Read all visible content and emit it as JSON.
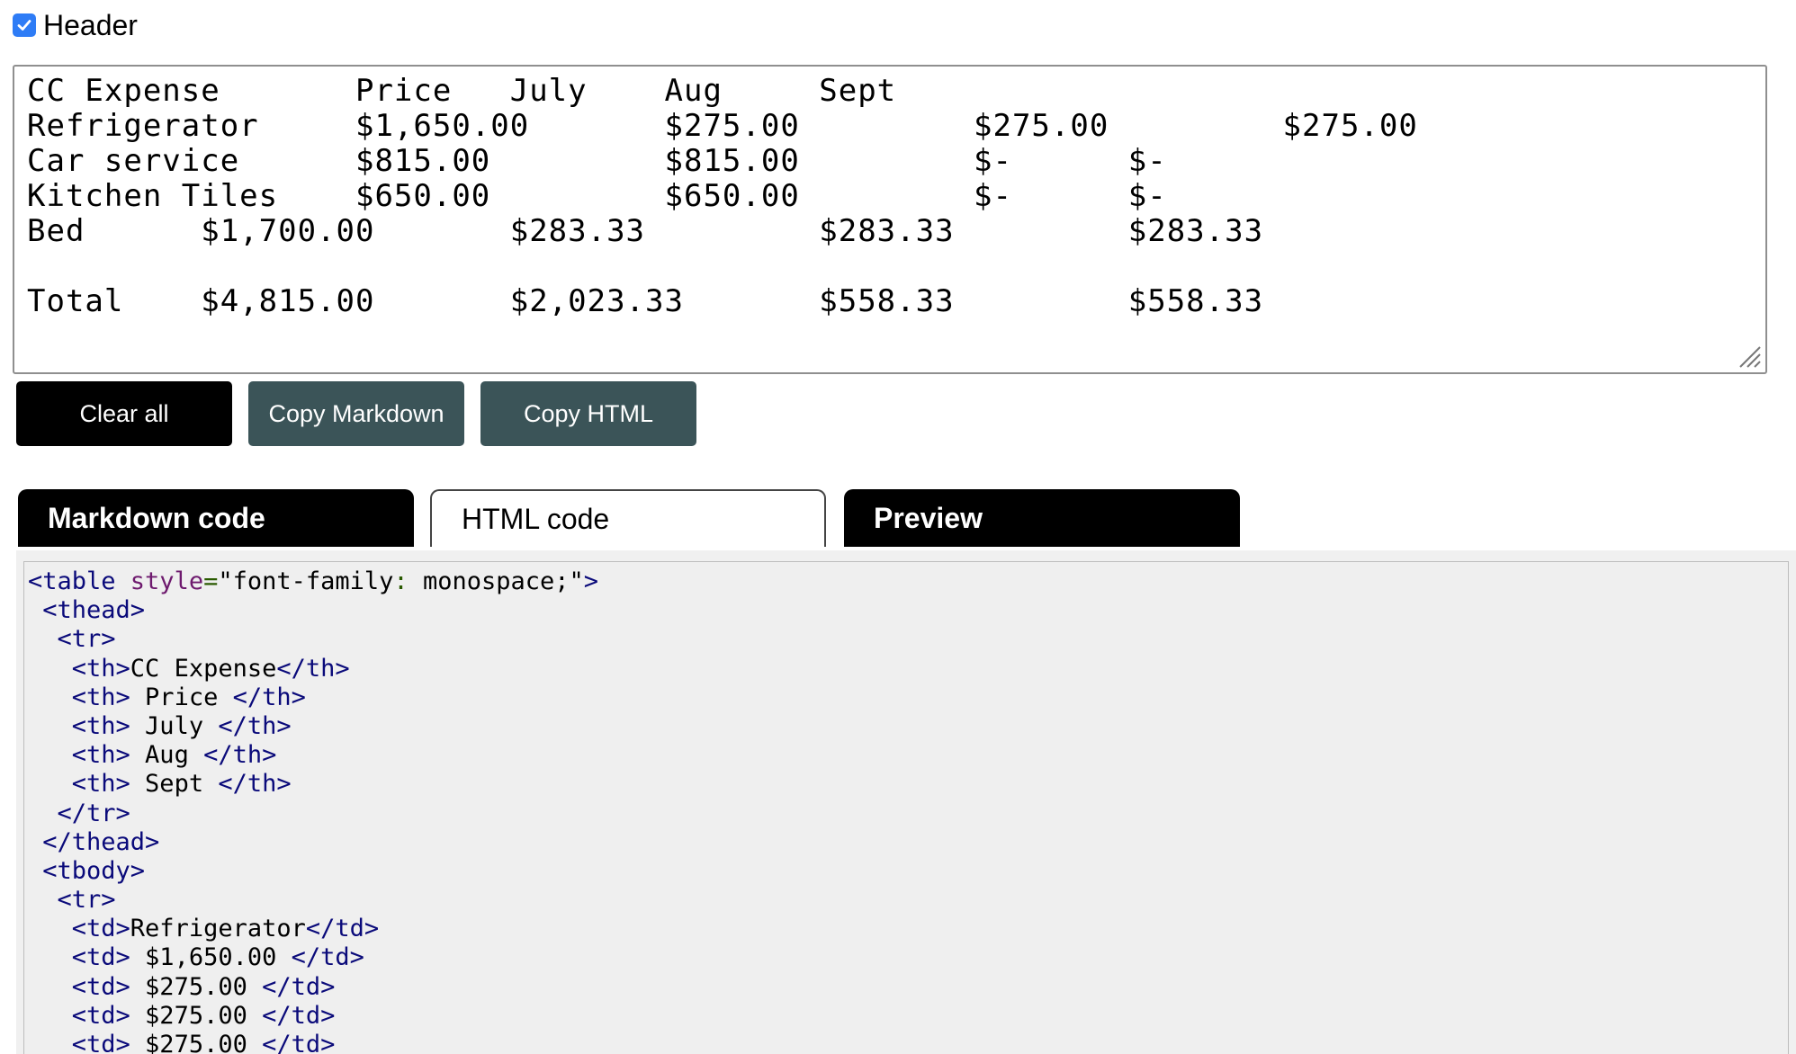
{
  "header_toggle": {
    "label": "Header",
    "checked": true
  },
  "input_lines": [
    "CC Expense       Price   July    Aug     Sept",
    "Refrigerator     $1,650.00       $275.00         $275.00         $275.00",
    "Car service      $815.00         $815.00         $-      $-",
    "Kitchen Tiles    $650.00         $650.00         $-      $-",
    "Bed      $1,700.00       $283.33         $283.33         $283.33",
    "",
    "Total    $4,815.00       $2,023.33       $558.33         $558.33"
  ],
  "buttons": {
    "clear_all": "Clear all",
    "copy_markdown": "Copy Markdown",
    "copy_html": "Copy HTML"
  },
  "tabs": [
    {
      "label": "Markdown code",
      "active": false
    },
    {
      "label": "HTML code",
      "active": true
    },
    {
      "label": "Preview",
      "active": false
    }
  ],
  "code_lines": [
    [
      [
        "tag",
        "<table "
      ],
      [
        "attr",
        "style"
      ],
      [
        "eq",
        "="
      ],
      [
        "str",
        "\"font-family"
      ],
      [
        "eq",
        ":"
      ],
      [
        "str",
        " monospace;\""
      ],
      [
        "tag",
        ">"
      ]
    ],
    [
      [
        "tag",
        " <thead>"
      ]
    ],
    [
      [
        "tag",
        "  <tr>"
      ]
    ],
    [
      [
        "tag",
        "   <th>"
      ],
      [
        "str",
        "CC Expense"
      ],
      [
        "tag",
        "</th>"
      ]
    ],
    [
      [
        "tag",
        "   <th>"
      ],
      [
        "str",
        " Price "
      ],
      [
        "tag",
        "</th>"
      ]
    ],
    [
      [
        "tag",
        "   <th>"
      ],
      [
        "str",
        " July "
      ],
      [
        "tag",
        "</th>"
      ]
    ],
    [
      [
        "tag",
        "   <th>"
      ],
      [
        "str",
        " Aug "
      ],
      [
        "tag",
        "</th>"
      ]
    ],
    [
      [
        "tag",
        "   <th>"
      ],
      [
        "str",
        " Sept "
      ],
      [
        "tag",
        "</th>"
      ]
    ],
    [
      [
        "tag",
        "  </tr>"
      ]
    ],
    [
      [
        "tag",
        " </thead>"
      ]
    ],
    [
      [
        "tag",
        " <tbody>"
      ]
    ],
    [
      [
        "tag",
        "  <tr>"
      ]
    ],
    [
      [
        "tag",
        "   <td>"
      ],
      [
        "str",
        "Refrigerator"
      ],
      [
        "tag",
        "</td>"
      ]
    ],
    [
      [
        "tag",
        "   <td>"
      ],
      [
        "str",
        " $1,650.00 "
      ],
      [
        "tag",
        "</td>"
      ]
    ],
    [
      [
        "tag",
        "   <td>"
      ],
      [
        "str",
        " $275.00 "
      ],
      [
        "tag",
        "</td>"
      ]
    ],
    [
      [
        "tag",
        "   <td>"
      ],
      [
        "str",
        " $275.00 "
      ],
      [
        "tag",
        "</td>"
      ]
    ],
    [
      [
        "tag",
        "   <td>"
      ],
      [
        "str",
        " $275.00 "
      ],
      [
        "tag",
        "</td>"
      ]
    ]
  ],
  "colors": {
    "checkbox": "#2e7cf6",
    "button_dark": "#000000",
    "button_slate": "#3b5458",
    "code_bg": "#efefef",
    "tag": "#0a0a7a",
    "attr": "#6e1a6e"
  }
}
